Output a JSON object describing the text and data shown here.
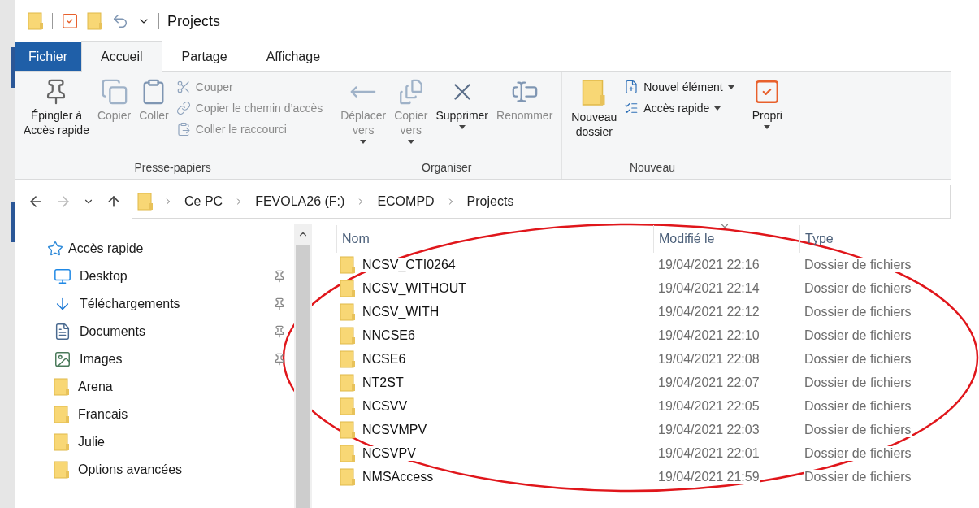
{
  "title_bar": {
    "title": "Projects"
  },
  "ribbon_tabs": [
    {
      "label": "Fichier",
      "kind": "file",
      "selected": false
    },
    {
      "label": "Accueil",
      "kind": "tab",
      "selected": true
    },
    {
      "label": "Partage",
      "kind": "tab",
      "selected": false
    },
    {
      "label": "Affichage",
      "kind": "tab",
      "selected": false
    }
  ],
  "ribbon_groups": [
    {
      "label": "Presse-papiers",
      "large_buttons": [
        {
          "label": "Épingler à\nAccès rapide",
          "disabled": false,
          "dropdown": false
        },
        {
          "label": "Copier",
          "disabled": true,
          "dropdown": false
        },
        {
          "label": "Coller",
          "disabled": true,
          "dropdown": false
        }
      ],
      "small_buttons": [
        {
          "label": "Couper",
          "disabled": true,
          "dropdown": false
        },
        {
          "label": "Copier le chemin d’accès",
          "disabled": true,
          "dropdown": false
        },
        {
          "label": "Coller le raccourci",
          "disabled": true,
          "dropdown": false
        }
      ]
    },
    {
      "label": "Organiser",
      "large_buttons": [
        {
          "label": "Déplacer\nvers",
          "disabled": true,
          "dropdown": true
        },
        {
          "label": "Copier\nvers",
          "disabled": true,
          "dropdown": true
        },
        {
          "label": "Supprimer",
          "disabled": false,
          "dropdown": true
        },
        {
          "label": "Renommer",
          "disabled": true,
          "dropdown": false
        }
      ]
    },
    {
      "label": "Nouveau",
      "large_buttons": [
        {
          "label": "Nouveau\ndossier",
          "disabled": false,
          "dropdown": false
        }
      ],
      "small_buttons": [
        {
          "label": "Nouvel élément",
          "disabled": false,
          "dropdown": true
        },
        {
          "label": "Accès rapide",
          "disabled": false,
          "dropdown": true
        }
      ]
    },
    {
      "large_buttons": [
        {
          "label": "Propri",
          "disabled": false,
          "dropdown": true
        }
      ]
    }
  ],
  "address_bar": {
    "back_disabled": false,
    "forward_disabled": true,
    "path": [
      "Ce PC",
      "FEVOLA26 (F:)",
      "ECOMPD",
      "Projects"
    ]
  },
  "sidebar": {
    "header": "Accès rapide",
    "items": [
      {
        "label": "Desktop",
        "pinned": true
      },
      {
        "label": "Téléchargements",
        "pinned": true
      },
      {
        "label": "Documents",
        "pinned": true
      },
      {
        "label": "Images",
        "pinned": true
      },
      {
        "label": "Arena",
        "pinned": false
      },
      {
        "label": "Francais",
        "pinned": false
      },
      {
        "label": "Julie",
        "pinned": false
      },
      {
        "label": "Options avancées",
        "pinned": false
      }
    ]
  },
  "table": {
    "columns": [
      {
        "label": "Nom",
        "sorted": false
      },
      {
        "label": "Modifié le",
        "sorted": true
      },
      {
        "label": "Type",
        "sorted": false
      }
    ],
    "rows": [
      [
        "NCSV_CTI0264",
        "19/04/2021 22:16",
        "Dossier de fichiers"
      ],
      [
        "NCSV_WITHOUT",
        "19/04/2021 22:14",
        "Dossier de fichiers"
      ],
      [
        "NCSV_WITH",
        "19/04/2021 22:12",
        "Dossier de fichiers"
      ],
      [
        "NNCSE6",
        "19/04/2021 22:10",
        "Dossier de fichiers"
      ],
      [
        "NCSE6",
        "19/04/2021 22:08",
        "Dossier de fichiers"
      ],
      [
        "NT2ST",
        "19/04/2021 22:07",
        "Dossier de fichiers"
      ],
      [
        "NCSVV",
        "19/04/2021 22:05",
        "Dossier de fichiers"
      ],
      [
        "NCSVMPV",
        "19/04/2021 22:03",
        "Dossier de fichiers"
      ],
      [
        "NCSVPV",
        "19/04/2021 22:01",
        "Dossier de fichiers"
      ],
      [
        "NMSAccess",
        "19/04/2021 21:59",
        "Dossier de fichiers"
      ]
    ]
  }
}
